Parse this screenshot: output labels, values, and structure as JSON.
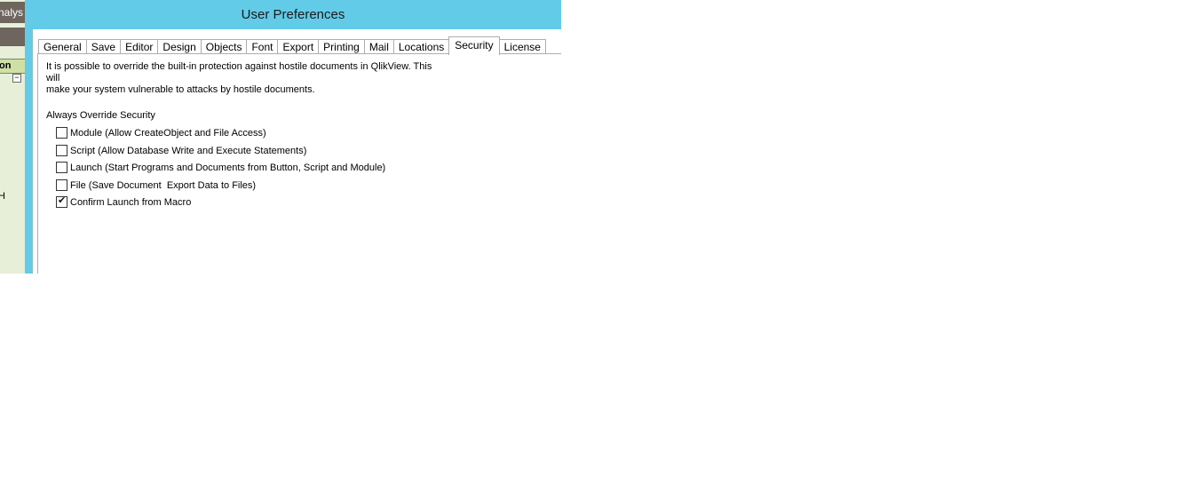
{
  "background_app": {
    "title_fragment": "nalys",
    "header_fragment": "on",
    "collapse_symbol": "−",
    "letter_fragment": "H"
  },
  "dialog": {
    "title": "User Preferences",
    "tabs": [
      {
        "label": "General"
      },
      {
        "label": "Save"
      },
      {
        "label": "Editor"
      },
      {
        "label": "Design"
      },
      {
        "label": "Objects"
      },
      {
        "label": "Font"
      },
      {
        "label": "Export"
      },
      {
        "label": "Printing"
      },
      {
        "label": "Mail"
      },
      {
        "label": "Locations"
      },
      {
        "label": "Security",
        "active": true
      },
      {
        "label": "License"
      }
    ],
    "security": {
      "intro_line1": "It is possible to override the built-in protection against hostile documents in QlikView. This will",
      "intro_line2": "make your system vulnerable to attacks by hostile documents.",
      "section_label": "Always Override Security",
      "options": [
        {
          "label": "Module (Allow CreateObject and File Access)",
          "checked": false
        },
        {
          "label": "Script (Allow Database Write and Execute Statements)",
          "checked": false
        },
        {
          "label": "Launch (Start Programs and Documents from Button, Script and Module)",
          "checked": false
        },
        {
          "label": "File (Save Document  Export Data to Files)",
          "checked": false
        },
        {
          "label": "Confirm Launch from Macro",
          "checked": true
        }
      ]
    }
  },
  "colors": {
    "title_bar": "#62cbe8",
    "background_app_accent": "#6d655e",
    "background_app_header": "#cfe0a6"
  }
}
